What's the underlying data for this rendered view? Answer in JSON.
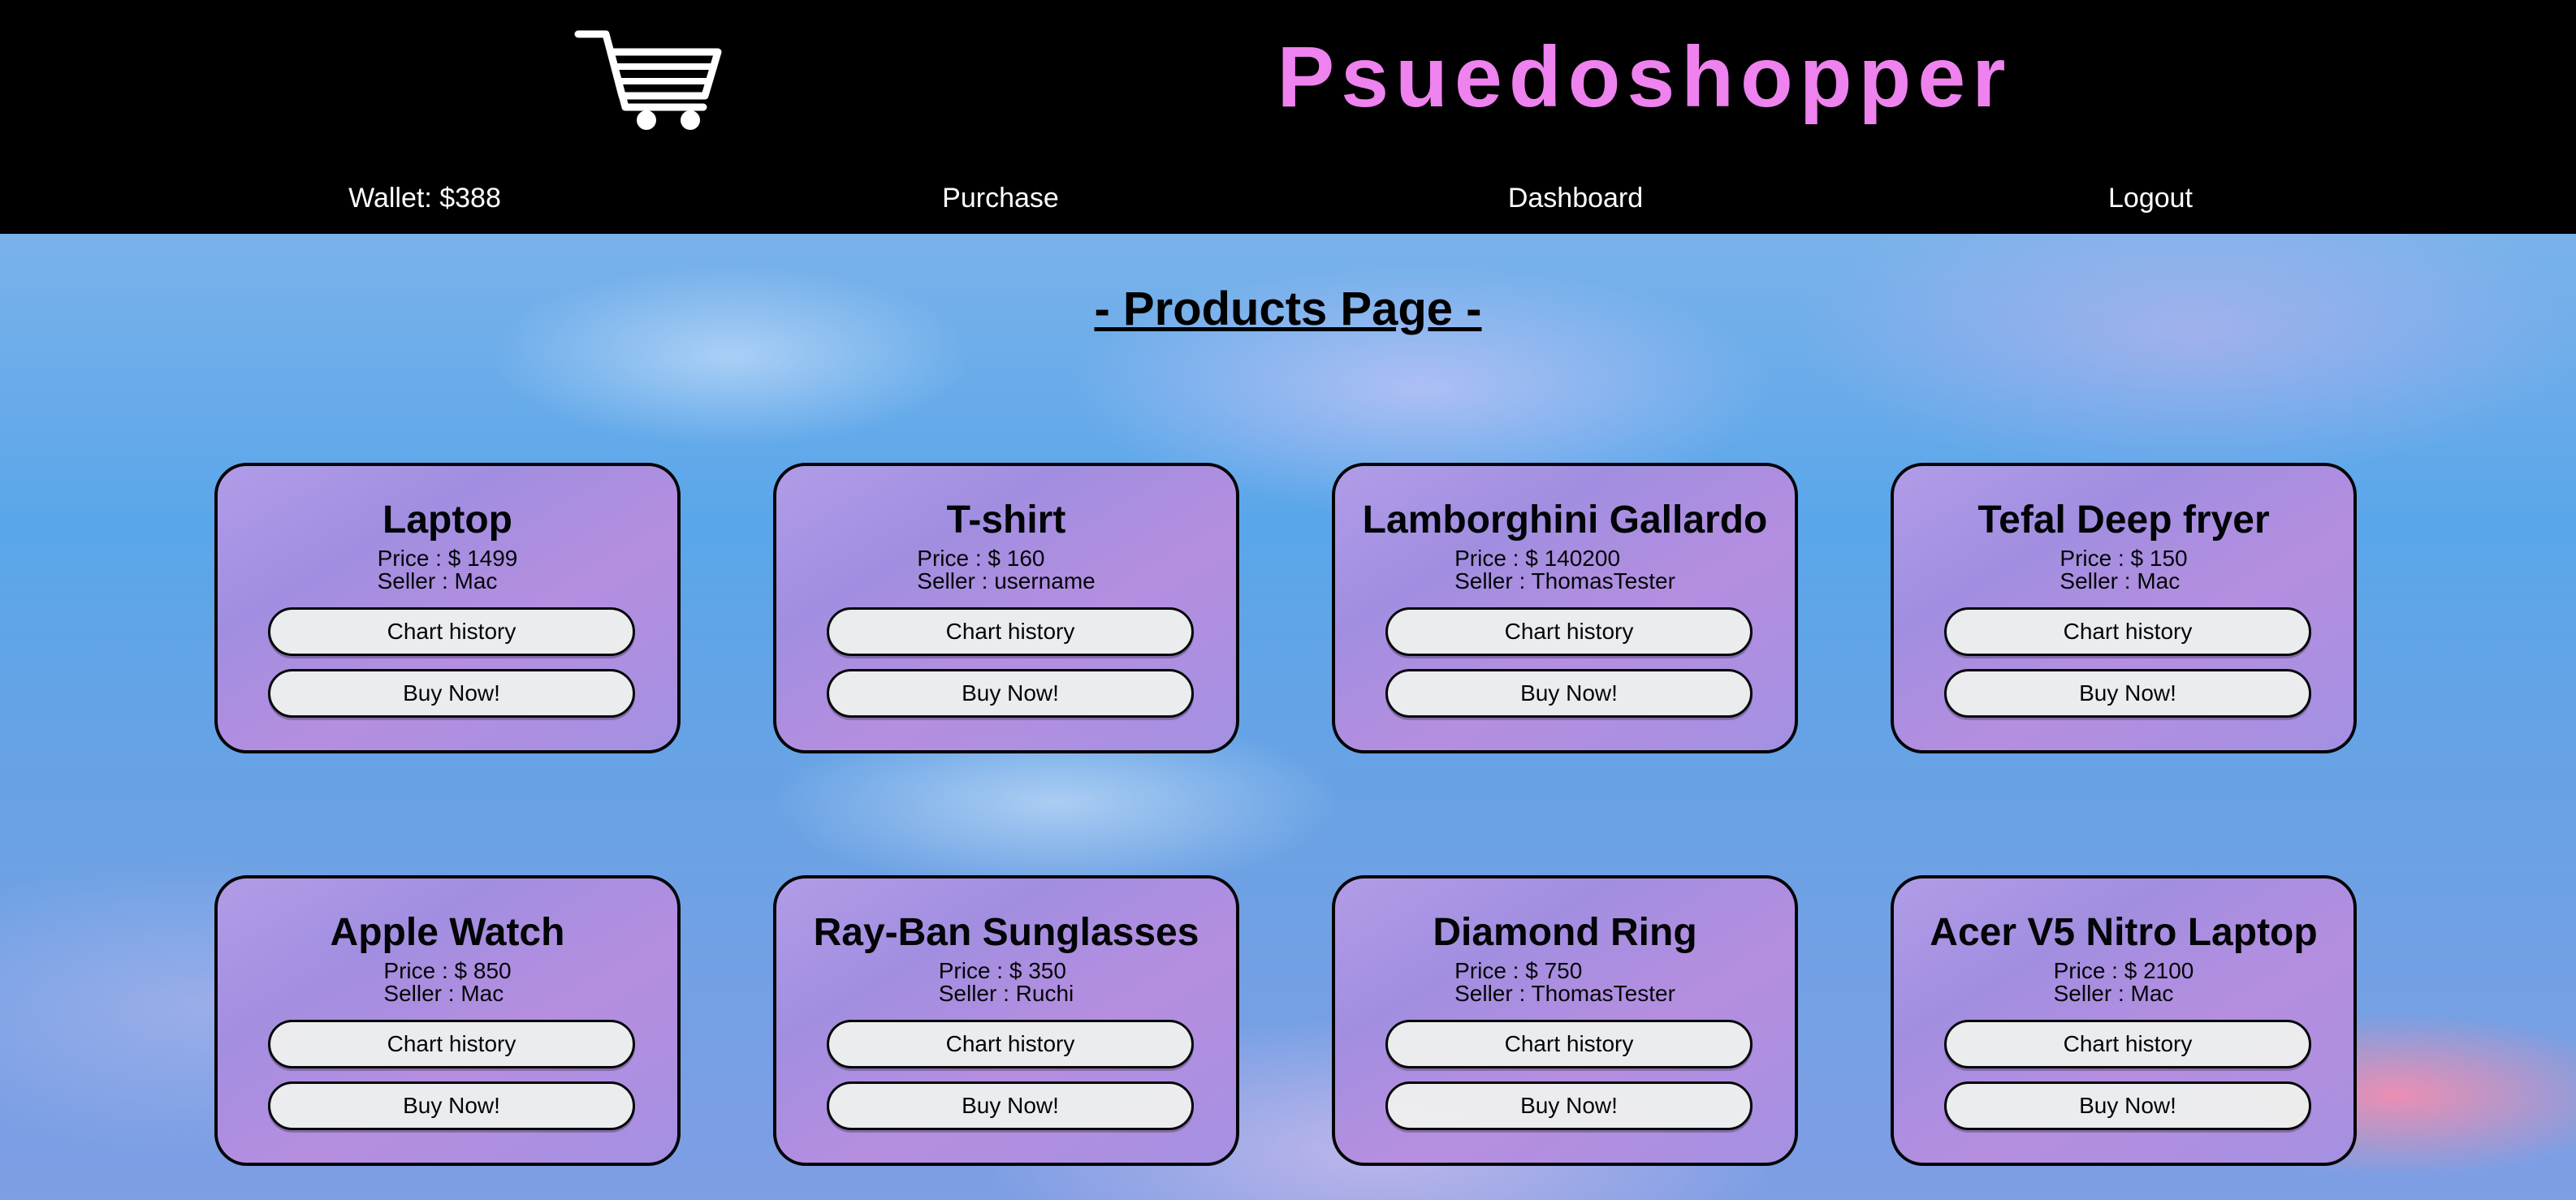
{
  "header": {
    "brand": "Psuedoshopper",
    "logo_icon": "shopping-cart-icon",
    "brand_color": "#ee82ee"
  },
  "nav": {
    "wallet": "Wallet: $388",
    "purchase": "Purchase",
    "dashboard": "Dashboard",
    "logout": "Logout"
  },
  "main": {
    "heading": "- Products Page -"
  },
  "products": [
    {
      "name": "Laptop",
      "price": "Price : $ 1499",
      "seller": "Seller : Mac",
      "chart_label": "Chart history",
      "buy_label": "Buy Now!"
    },
    {
      "name": "T-shirt",
      "price": "Price : $ 160",
      "seller": "Seller : username",
      "chart_label": "Chart history",
      "buy_label": "Buy Now!"
    },
    {
      "name": "Lamborghini Gallardo",
      "price": "Price : $ 140200",
      "seller": "Seller : ThomasTester",
      "chart_label": "Chart history",
      "buy_label": "Buy Now!"
    },
    {
      "name": "Tefal Deep fryer",
      "price": "Price : $ 150",
      "seller": "Seller : Mac",
      "chart_label": "Chart history",
      "buy_label": "Buy Now!"
    },
    {
      "name": "Apple Watch",
      "price": "Price : $ 850",
      "seller": "Seller : Mac",
      "chart_label": "Chart history",
      "buy_label": "Buy Now!"
    },
    {
      "name": "Ray-Ban Sunglasses",
      "price": "Price : $ 350",
      "seller": "Seller : Ruchi",
      "chart_label": "Chart history",
      "buy_label": "Buy Now!"
    },
    {
      "name": "Diamond Ring",
      "price": "Price : $ 750",
      "seller": "Seller : ThomasTester",
      "chart_label": "Chart history",
      "buy_label": "Buy Now!"
    },
    {
      "name": "Acer V5 Nitro Laptop",
      "price": "Price : $ 2100",
      "seller": "Seller : Mac",
      "chart_label": "Chart history",
      "buy_label": "Buy Now!"
    }
  ]
}
